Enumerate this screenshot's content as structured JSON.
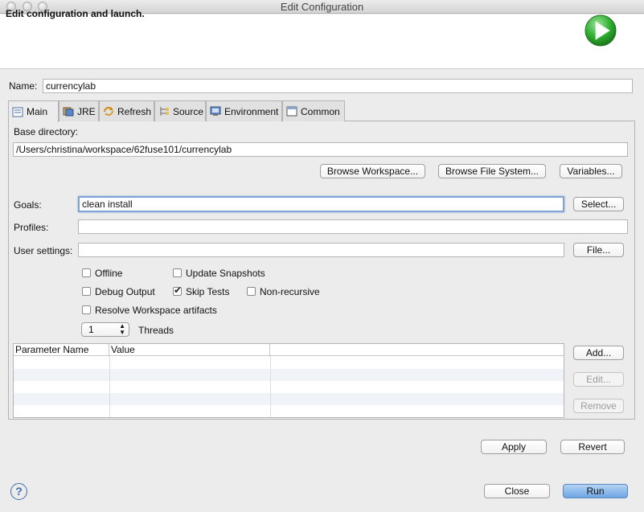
{
  "window": {
    "title": "Edit Configuration"
  },
  "header": {
    "title": "Edit configuration and launch."
  },
  "name": {
    "label": "Name:",
    "value": "currencylab"
  },
  "tabs": [
    {
      "label": "Main",
      "icon": "main-tab-icon"
    },
    {
      "label": "JRE",
      "icon": "jre-icon"
    },
    {
      "label": "Refresh",
      "icon": "refresh-icon"
    },
    {
      "label": "Source",
      "icon": "source-icon"
    },
    {
      "label": "Environment",
      "icon": "environment-icon"
    },
    {
      "label": "Common",
      "icon": "common-icon"
    }
  ],
  "main": {
    "base_dir_label": "Base directory:",
    "base_dir_value": "/Users/christina/workspace/62fuse101/currencylab",
    "browse_workspace": "Browse Workspace...",
    "browse_fs": "Browse File System...",
    "variables": "Variables...",
    "goals_label": "Goals:",
    "goals_value": "clean install",
    "select": "Select...",
    "profiles_label": "Profiles:",
    "profiles_value": "",
    "user_settings_label": "User settings:",
    "user_settings_value": "",
    "file": "File...",
    "options": {
      "offline": {
        "label": "Offline",
        "checked": false
      },
      "update_snapshots": {
        "label": "Update Snapshots",
        "checked": false
      },
      "debug_output": {
        "label": "Debug Output",
        "checked": false
      },
      "skip_tests": {
        "label": "Skip Tests",
        "checked": true
      },
      "non_recursive": {
        "label": "Non-recursive",
        "checked": false
      },
      "resolve_workspace": {
        "label": "Resolve Workspace artifacts",
        "checked": false
      }
    },
    "threads_value": "1",
    "threads_label": "Threads",
    "table": {
      "col_name": "Parameter Name",
      "col_value": "Value",
      "rows": []
    },
    "add": "Add...",
    "edit": "Edit...",
    "remove": "Remove"
  },
  "apply": "Apply",
  "revert": "Revert",
  "close": "Close",
  "run": "Run",
  "help": "?",
  "colors": {
    "run_green": "#2fae2f",
    "primary_button": "#6fa5e2",
    "focus_ring": "#7ea3d6"
  }
}
